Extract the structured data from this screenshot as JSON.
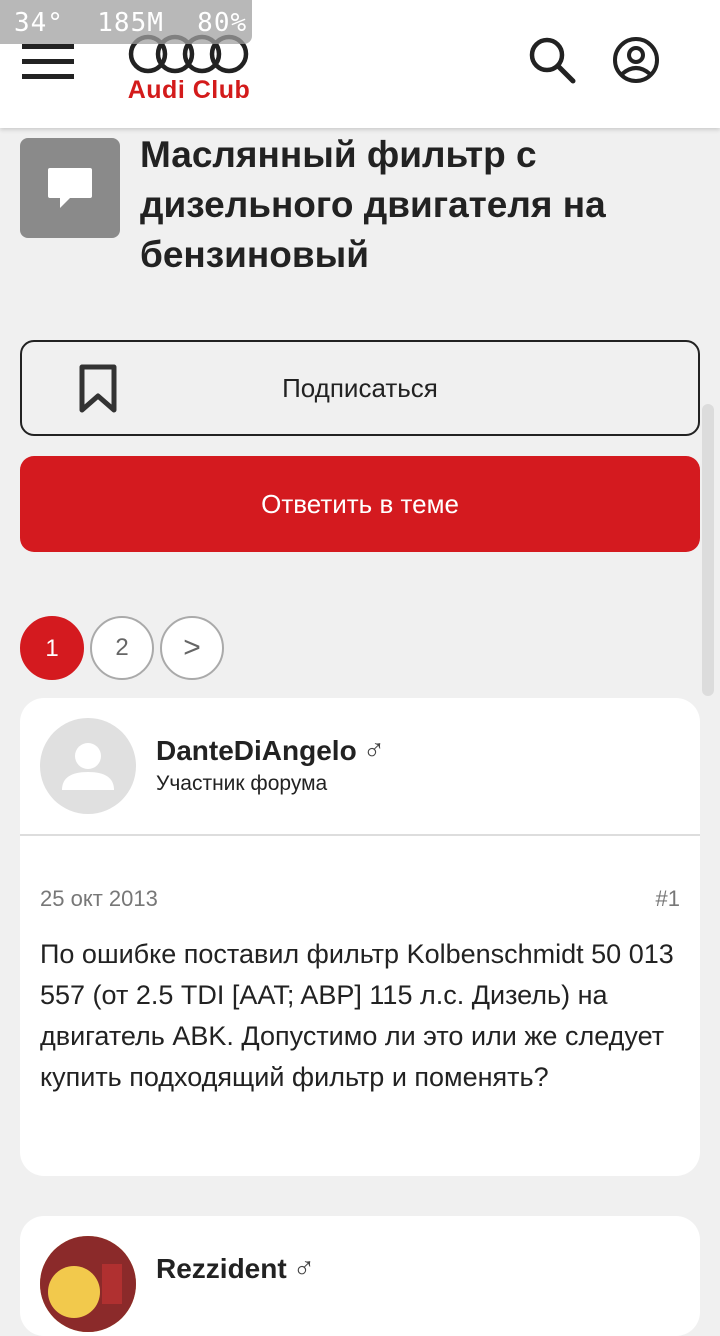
{
  "status_bar": {
    "text": "34°  185M  80%"
  },
  "header": {
    "logo_text": "Audi Club",
    "brand_color": "#d31b1b",
    "icons": [
      "menu-icon",
      "search-icon",
      "account-icon"
    ]
  },
  "thread": {
    "title": "Маслянный фильтр с дизельного двигателя на бензиновый",
    "subscribe_label": "Подписаться",
    "reply_label": "Ответить в теме",
    "accent_color": "#d41a1f"
  },
  "pagination": {
    "pages": [
      "1",
      "2"
    ],
    "current": "1",
    "next": ">"
  },
  "posts": [
    {
      "username": "DanteDiAngelo",
      "gender": "♂",
      "role": "Участник форума",
      "date": "25 окт 2013",
      "number": "#1",
      "body": "По ошибке поставил фильтр Kolbenschmidt 50 013 557 (от 2.5 TDI [AAT; ABP] 115 л.с. Дизель) на двигатель ABK. Допустимо ли это или же следует купить подходящий фильтр и поменять?"
    },
    {
      "username": "Rezzident",
      "gender": "♂"
    }
  ]
}
